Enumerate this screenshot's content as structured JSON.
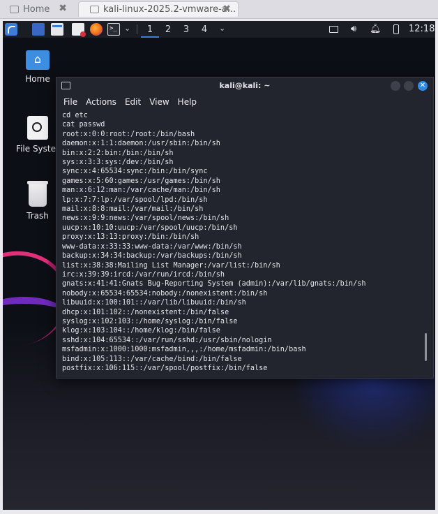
{
  "host_tabs": [
    {
      "label": "Home",
      "close": "✖"
    },
    {
      "label": "kali-linux-2025.2-vmware-a...",
      "close": "✖"
    }
  ],
  "panel": {
    "workspaces": [
      "1",
      "2",
      "3",
      "4"
    ],
    "clock": "12:18",
    "chevron": "⌄"
  },
  "desktop": {
    "icons": [
      {
        "label": "Home",
        "icon": "home-folder-icon"
      },
      {
        "label": "File Syster",
        "icon": "filesystem-icon"
      },
      {
        "label": "Trash",
        "icon": "trash-icon"
      }
    ]
  },
  "terminal": {
    "title": "kali@kali: ~",
    "menu": [
      "File",
      "Actions",
      "Edit",
      "View",
      "Help"
    ],
    "lines": [
      "cd etc",
      "cat passwd",
      "root:x:0:0:root:/root:/bin/bash",
      "daemon:x:1:1:daemon:/usr/sbin:/bin/sh",
      "bin:x:2:2:bin:/bin:/bin/sh",
      "sys:x:3:3:sys:/dev:/bin/sh",
      "sync:x:4:65534:sync:/bin:/bin/sync",
      "games:x:5:60:games:/usr/games:/bin/sh",
      "man:x:6:12:man:/var/cache/man:/bin/sh",
      "lp:x:7:7:lp:/var/spool/lpd:/bin/sh",
      "mail:x:8:8:mail:/var/mail:/bin/sh",
      "news:x:9:9:news:/var/spool/news:/bin/sh",
      "uucp:x:10:10:uucp:/var/spool/uucp:/bin/sh",
      "proxy:x:13:13:proxy:/bin:/bin/sh",
      "www-data:x:33:33:www-data:/var/www:/bin/sh",
      "backup:x:34:34:backup:/var/backups:/bin/sh",
      "list:x:38:38:Mailing List Manager:/var/list:/bin/sh",
      "irc:x:39:39:ircd:/var/run/ircd:/bin/sh",
      "gnats:x:41:41:Gnats Bug-Reporting System (admin):/var/lib/gnats:/bin/sh",
      "nobody:x:65534:65534:nobody:/nonexistent:/bin/sh",
      "libuuid:x:100:101::/var/lib/libuuid:/bin/sh",
      "dhcp:x:101:102::/nonexistent:/bin/false",
      "syslog:x:102:103::/home/syslog:/bin/false",
      "klog:x:103:104::/home/klog:/bin/false",
      "sshd:x:104:65534::/var/run/sshd:/usr/sbin/nologin",
      "msfadmin:x:1000:1000:msfadmin,,,:/home/msfadmin:/bin/bash",
      "bind:x:105:113::/var/cache/bind:/bin/false",
      "postfix:x:106:115::/var/spool/postfix:/bin/false"
    ]
  },
  "colors": {
    "accent": "#2f8ae5",
    "terminal_bg": "#23252e",
    "panel_bg": "#1b1d25"
  }
}
